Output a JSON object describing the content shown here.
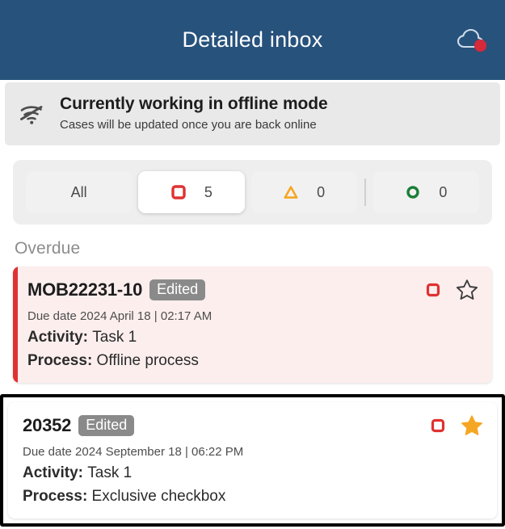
{
  "header": {
    "title": "Detailed inbox",
    "sync_icon": "cloud-offline-icon",
    "sync_dot_color": "#d6293a",
    "background": "#27527c"
  },
  "offline_banner": {
    "icon": "wifi-off-icon",
    "title": "Currently working in offline mode",
    "subtitle": "Cases will be updated once you are back online"
  },
  "filters": {
    "items": [
      {
        "label": "All",
        "icon": "",
        "count": "",
        "selected": false
      },
      {
        "label": "",
        "icon": "red-square-icon",
        "count": "5",
        "selected": true
      },
      {
        "label": "",
        "icon": "orange-triangle-icon",
        "count": "0",
        "selected": false
      },
      {
        "label": "",
        "icon": "green-circle-icon",
        "count": "0",
        "selected": false
      }
    ],
    "colors": {
      "red": "#e03131",
      "orange": "#f5a623",
      "green": "#1a7f37"
    }
  },
  "sections": [
    {
      "label": "Overdue",
      "cases": [
        {
          "id": "MOB22231-10",
          "badge": "Edited",
          "due": "Due date 2024 April 18 | 02:17 AM",
          "activity_label": "Activity:",
          "activity_value": "Task 1",
          "process_label": "Process:",
          "process_value": "Offline process",
          "status_icon": "red-square-icon",
          "star": "star-outline-icon",
          "starred": false,
          "overdue": true,
          "focused": false
        },
        {
          "id": "20352",
          "badge": "Edited",
          "due": "Due date 2024 September 18 | 06:22 PM",
          "activity_label": "Activity:",
          "activity_value": "Task 1",
          "process_label": "Process:",
          "process_value": "Exclusive checkbox",
          "status_icon": "red-square-icon",
          "star": "star-filled-icon",
          "starred": true,
          "overdue": false,
          "focused": true
        }
      ]
    }
  ]
}
